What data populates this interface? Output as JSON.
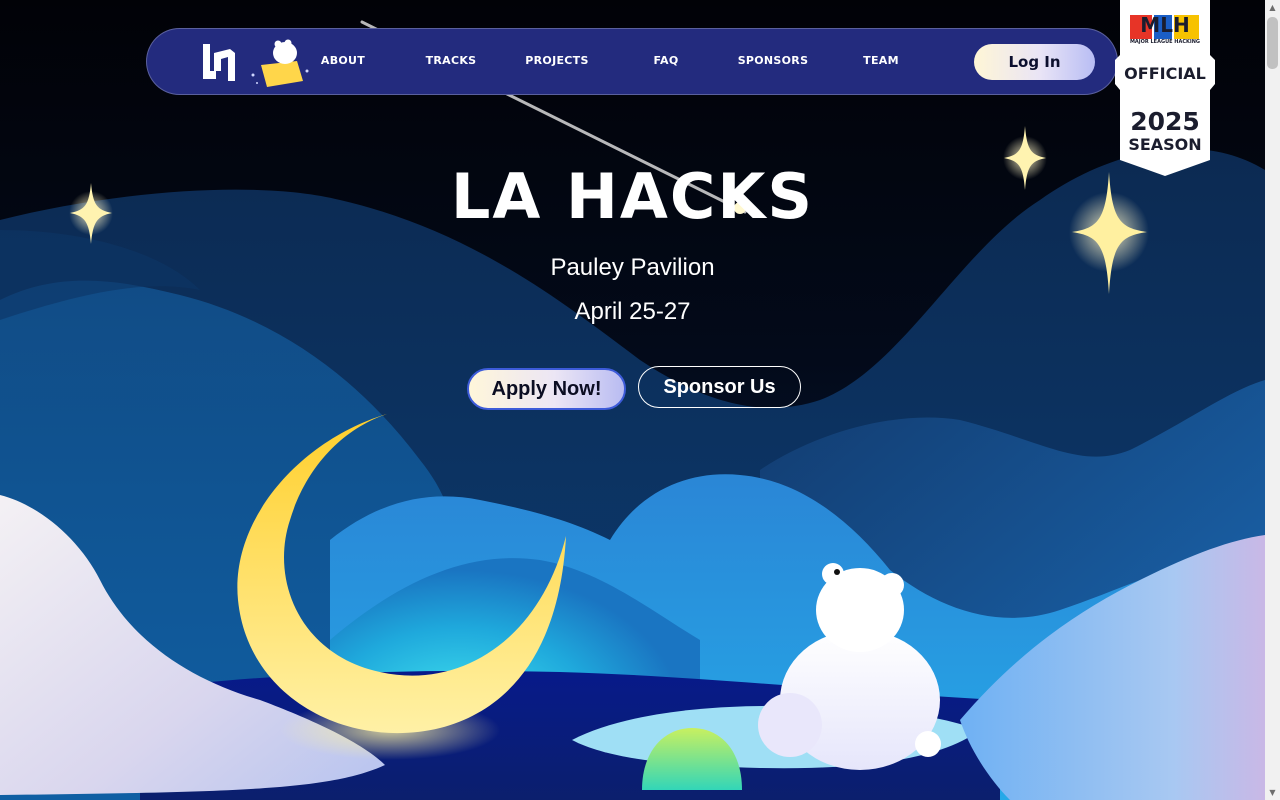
{
  "nav": {
    "logo_icon": "la-hacks-logo-icon",
    "mascot_icon": "polar-bear-on-star-icon",
    "items": [
      {
        "label": "ABOUT"
      },
      {
        "label": "TRACKS"
      },
      {
        "label": "PROJECTS"
      },
      {
        "label": "FAQ"
      },
      {
        "label": "SPONSORS"
      },
      {
        "label": "TEAM"
      }
    ],
    "login_label": "Log In"
  },
  "mlh_badge": {
    "logo_text": "MLH",
    "tagline": "MAJOR LEAGUE HACKING",
    "official": "OFFICIAL",
    "year": "2025",
    "season": "SEASON"
  },
  "hero": {
    "title": "LA HACKS",
    "venue": "Pauley Pavilion",
    "dates": "April 25-27",
    "apply_label": "Apply Now!",
    "sponsor_label": "Sponsor Us"
  },
  "colors": {
    "nav_bg": "#232b7e",
    "sky": "#02040c",
    "moon": "#ffd84a",
    "button_gradient_start": "#fff6da",
    "button_gradient_end": "#b9bcf2"
  },
  "illustration": {
    "icons": [
      "moon-icon",
      "polar-bear-icon",
      "sparkle-star-icon",
      "shooting-star-icon",
      "glowing-orb-icon"
    ]
  }
}
